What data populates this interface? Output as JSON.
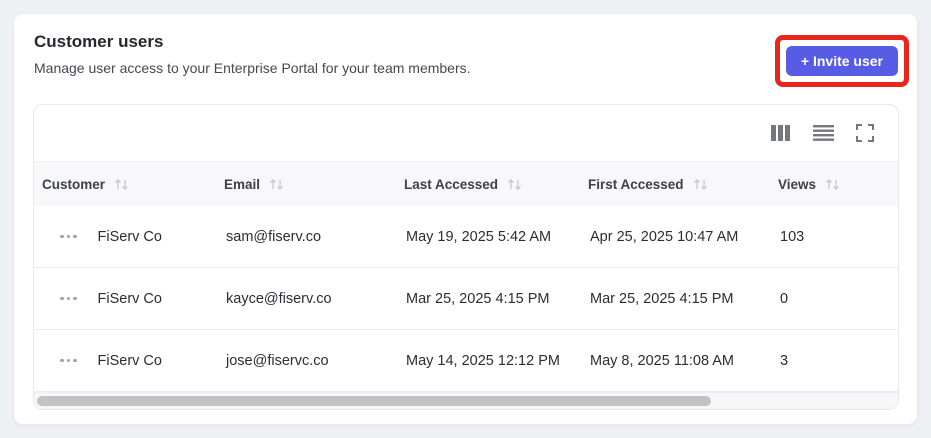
{
  "colors": {
    "accent": "#585ce5",
    "highlight_outline": "#e7261d",
    "header_bg": "#f8f8fb",
    "page_bg": "#eef1f4"
  },
  "panel": {
    "title": "Customer users",
    "subtitle": "Manage user access to your Enterprise Portal for your team members.",
    "invite_button": {
      "label": "+ Invite user"
    }
  },
  "toolbar": {
    "icons": [
      {
        "name": "view-columns-icon"
      },
      {
        "name": "density-icon"
      },
      {
        "name": "fullscreen-icon"
      }
    ]
  },
  "table": {
    "columns": [
      {
        "label": "Customer",
        "sortable": true
      },
      {
        "label": "Email",
        "sortable": true
      },
      {
        "label": "Last Accessed",
        "sortable": true
      },
      {
        "label": "First Accessed",
        "sortable": true
      },
      {
        "label": "Views",
        "sortable": true
      }
    ],
    "rows": [
      {
        "customer": "FiServ Co",
        "email": "sam@fiserv.co",
        "last_accessed": "May 19, 2025 5:42 AM",
        "first_accessed": "Apr 25, 2025 10:47 AM",
        "views": "103"
      },
      {
        "customer": "FiServ Co",
        "email": "kayce@fiserv.co",
        "last_accessed": "Mar 25, 2025 4:15 PM",
        "first_accessed": "Mar 25, 2025 4:15 PM",
        "views": "0"
      },
      {
        "customer": "FiServ Co",
        "email": "jose@fiservc.co",
        "last_accessed": "May 14, 2025 12:12 PM",
        "first_accessed": "May 8, 2025 11:08 AM",
        "views": "3"
      }
    ]
  }
}
